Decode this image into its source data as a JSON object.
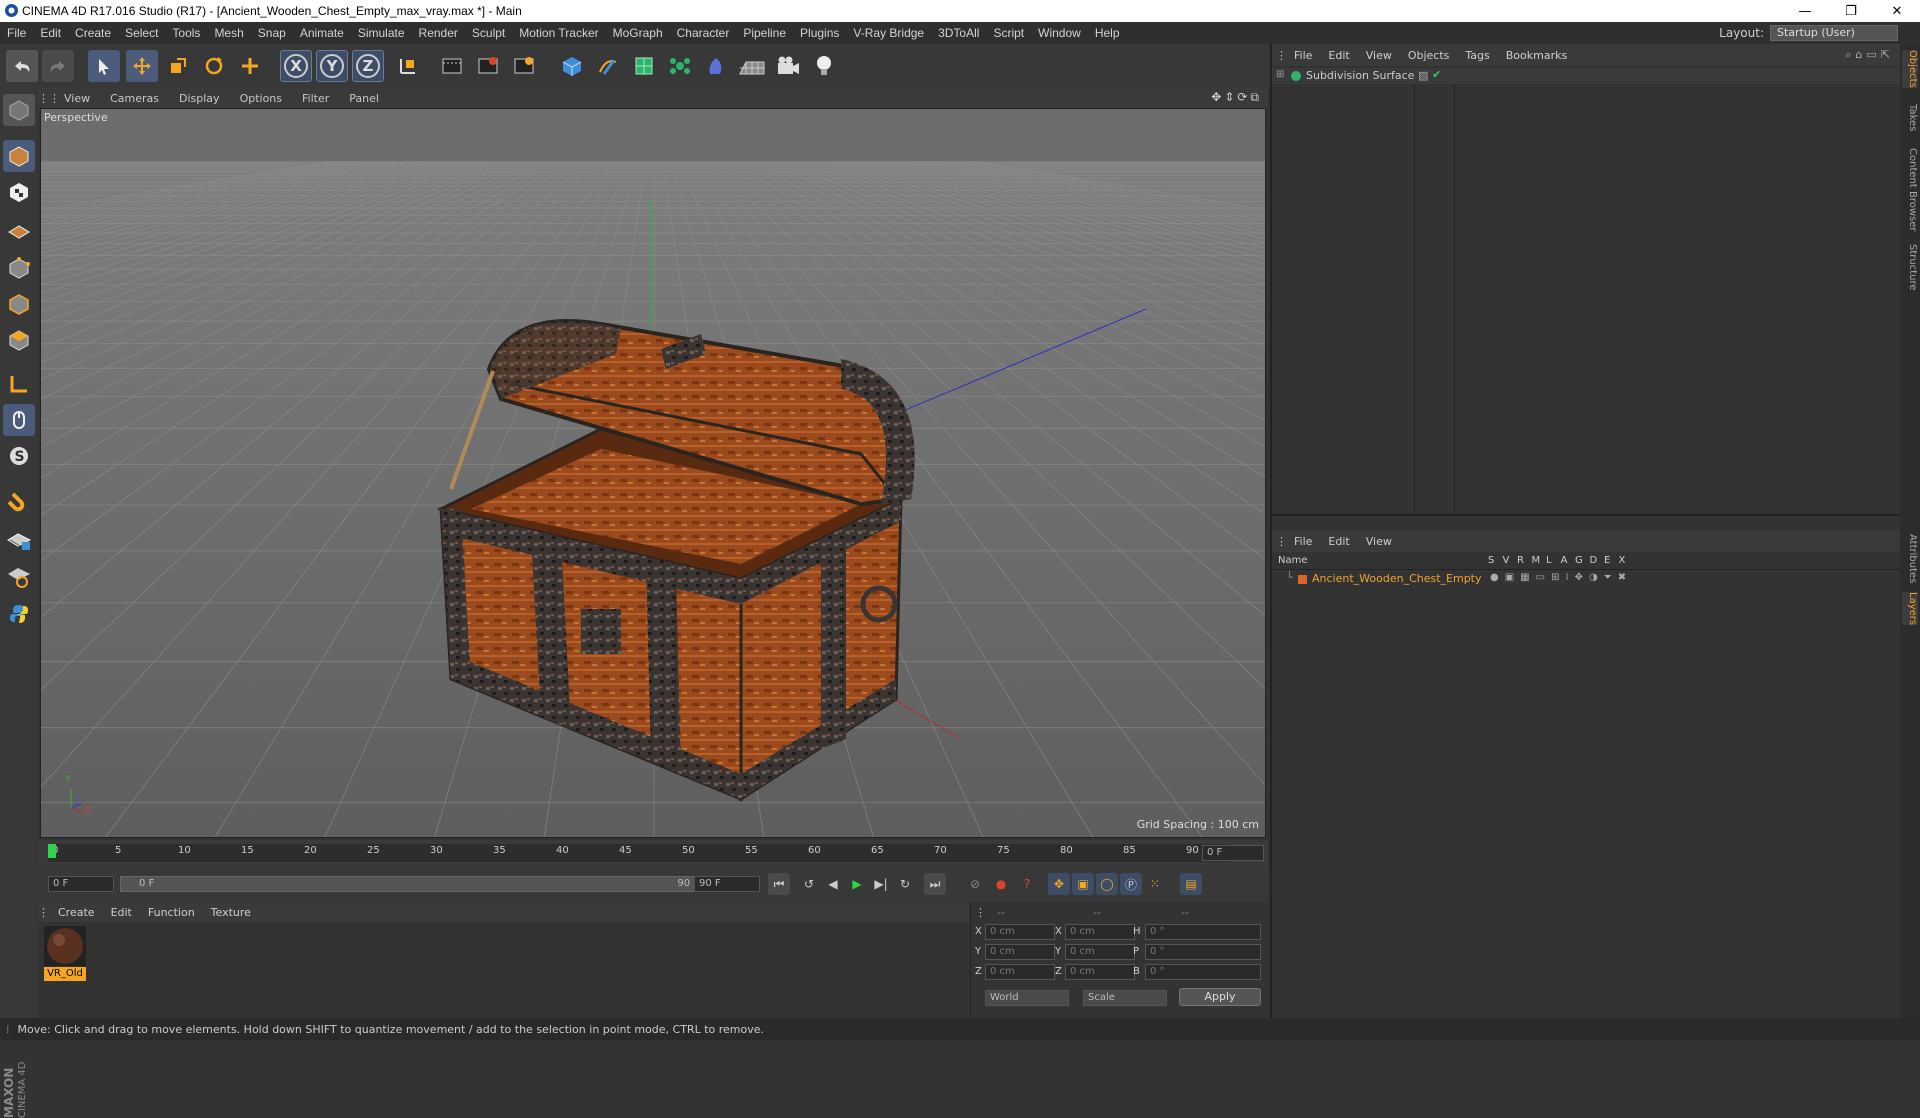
{
  "window": {
    "title": "CINEMA 4D R17.016 Studio (R17) - [Ancient_Wooden_Chest_Empty_max_vray.max *] - Main",
    "minimize": "—",
    "restore": "❐",
    "close": "✕"
  },
  "menu": [
    "File",
    "Edit",
    "Create",
    "Select",
    "Tools",
    "Mesh",
    "Snap",
    "Animate",
    "Simulate",
    "Render",
    "Sculpt",
    "Motion Tracker",
    "MoGraph",
    "Character",
    "Pipeline",
    "Plugins",
    "V-Ray Bridge",
    "3DToAll",
    "Script",
    "Window",
    "Help"
  ],
  "layout": {
    "label": "Layout:",
    "value": "Startup (User)"
  },
  "toolbar": {
    "x": "X",
    "y": "Y",
    "z": "Z"
  },
  "viewport": {
    "menu": [
      "View",
      "Cameras",
      "Display",
      "Options",
      "Filter",
      "Panel"
    ],
    "label": "Perspective",
    "grid_spacing": "Grid Spacing : 100 cm",
    "axis_y": "Y",
    "axis_x": "X",
    "axis_z": "Z"
  },
  "timeline": {
    "ticks": [
      "0",
      "5",
      "10",
      "15",
      "20",
      "25",
      "30",
      "35",
      "40",
      "45",
      "50",
      "55",
      "60",
      "65",
      "70",
      "75",
      "80",
      "85",
      "90"
    ],
    "current": "0 F"
  },
  "transport": {
    "start": "0 F",
    "range_start": "0 F",
    "range_end": "90 F",
    "end": "90 F"
  },
  "material_manager": {
    "menu": [
      "Create",
      "Edit",
      "Function",
      "Texture"
    ],
    "material": "VR_Old"
  },
  "coordinates": {
    "header": [
      "--",
      "--",
      "--"
    ],
    "rows": [
      {
        "a": "X",
        "av": "0 cm",
        "b": "X",
        "bv": "0 cm",
        "c": "H",
        "cv": "0 °"
      },
      {
        "a": "Y",
        "av": "0 cm",
        "b": "Y",
        "bv": "0 cm",
        "c": "P",
        "cv": "0 °"
      },
      {
        "a": "Z",
        "av": "0 cm",
        "b": "Z",
        "bv": "0 cm",
        "c": "B",
        "cv": "0 °"
      }
    ],
    "mode1": "World",
    "mode2": "Scale",
    "apply": "Apply"
  },
  "objects_panel": {
    "menu": [
      "File",
      "Edit",
      "View",
      "Objects",
      "Tags",
      "Bookmarks"
    ],
    "items": [
      {
        "name": "Subdivision Surface"
      }
    ]
  },
  "layers_panel": {
    "menu": [
      "File",
      "Edit",
      "View"
    ],
    "name_header": "Name",
    "columns": [
      "S",
      "V",
      "R",
      "M",
      "L",
      "A",
      "G",
      "D",
      "E",
      "X"
    ],
    "items": [
      {
        "name": "Ancient_Wooden_Chest_Empty"
      }
    ]
  },
  "side_tabs": [
    "Objects",
    "Takes",
    "Content Browser",
    "Structure",
    "Attributes",
    "Layers"
  ],
  "status": "Move: Click and drag to move elements. Hold down SHIFT to quantize movement / add to the selection in point mode, CTRL to remove.",
  "brand": {
    "maxon": "MAXON",
    "c4d": "CINEMA 4D"
  },
  "colors": {
    "accent": "#f5a623",
    "selected_text": "#f0a030",
    "grid_bg": "#7a7a7a"
  }
}
